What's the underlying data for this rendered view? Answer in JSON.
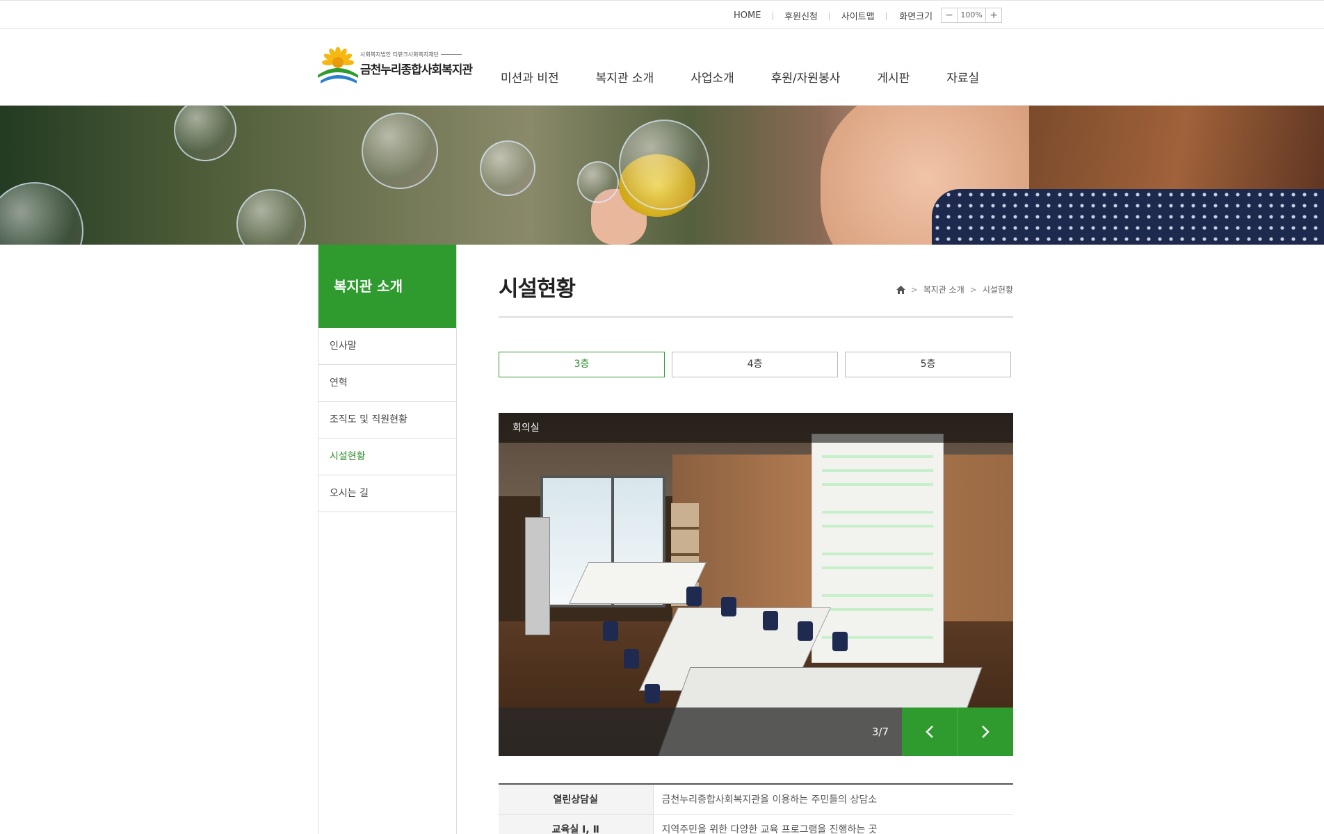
{
  "util": {
    "home": "HOME",
    "donate": "후원신청",
    "sitemap": "사이트맵",
    "zoom_label": "화면크기",
    "zoom_minus": "−",
    "zoom_value": "100%",
    "zoom_plus": "+"
  },
  "logo": {
    "subtitle": "사회복지법인 티뷰크사회복지재단",
    "name": "금천누리종합사회복지관"
  },
  "gnb": [
    "미션과 비전",
    "복지관 소개",
    "사업소개",
    "후원/자원봉사",
    "게시판",
    "자료실"
  ],
  "lnb": {
    "title": "복지관 소개",
    "items": [
      "인사말",
      "연혁",
      "조직도 및 직원현황",
      "시설현황",
      "오시는 길"
    ],
    "active_index": 3
  },
  "page": {
    "title": "시설현황",
    "breadcrumb": [
      "복지관 소개",
      "시설현황"
    ],
    "breadcrumb_sep": ">"
  },
  "floors": [
    "3층",
    "4층",
    "5층"
  ],
  "gallery": {
    "caption": "회의실",
    "counter": "3/7",
    "prev_icon": "chevron-left",
    "next_icon": "chevron-right"
  },
  "rooms": [
    {
      "name": "열린상담실",
      "desc": "금천누리종합사회복지관을 이용하는 주민들의 상담소"
    },
    {
      "name": "교육실 Ⅰ, Ⅱ",
      "desc": "지역주민을 위한 다양한 교육 프로그램을 진행하는 곳"
    }
  ],
  "colors": {
    "brand_green": "#2f9b2f",
    "active_text": "#2a8f2a"
  }
}
